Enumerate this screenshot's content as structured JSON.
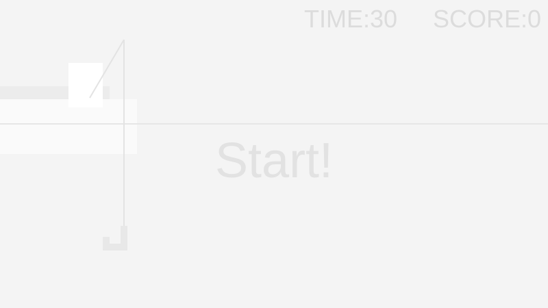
{
  "hud": {
    "time_text": "TIME:30",
    "score_text": "SCORE:0"
  },
  "game": {
    "start_label": "Start!"
  },
  "colors": {
    "background": "#f4f4f4",
    "hud_text": "#dcdcdc",
    "start_text": "#e2e2e2",
    "line": "#e6e6e6",
    "player": "#ffffff",
    "dock_dark": "#ececec",
    "dock_light": "#fafafa",
    "hook": "#e8e8e8"
  },
  "icons": {
    "hook": "fishing-hook-icon"
  }
}
